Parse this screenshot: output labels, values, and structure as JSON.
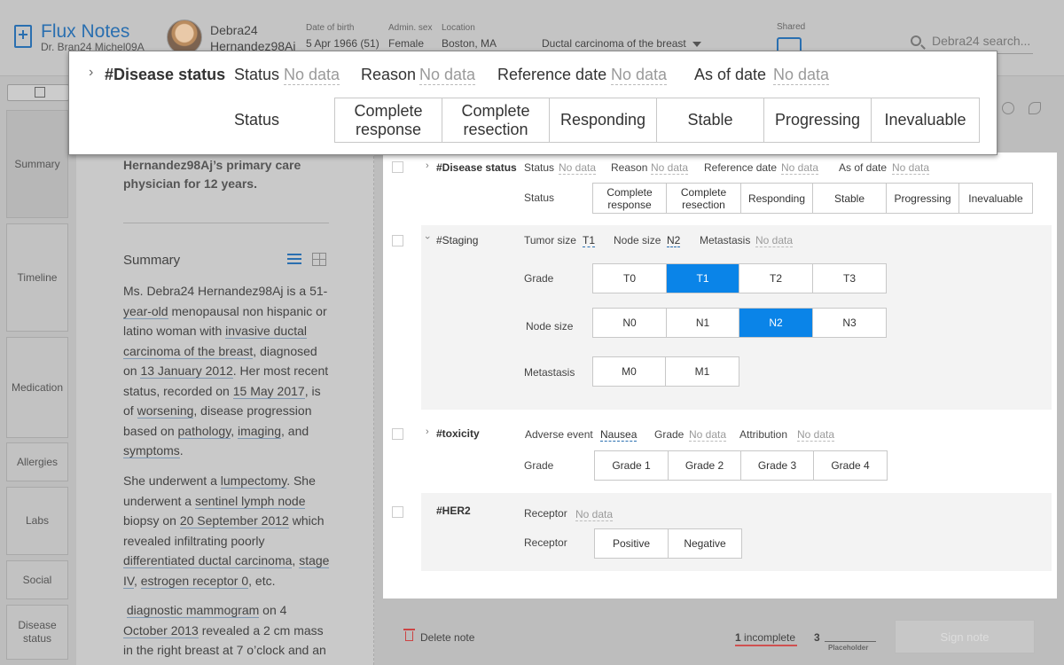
{
  "app": {
    "title": "Flux Notes",
    "user": "Dr. Bran24 Michel09A"
  },
  "patient": {
    "name_first": "Debra24",
    "name_last": "Hernandez98Aj",
    "dob_label": "Date of birth",
    "dob": "5 Apr 1966 (51)",
    "sex_label": "Admin. sex",
    "sex": "Female",
    "location_label": "Location",
    "location": "Boston, MA",
    "condition": "Ductal carcinoma of the breast"
  },
  "shared_label": "Shared",
  "search_placeholder": "Debra24 search...",
  "nav": [
    "Summary",
    "Timeline",
    "Medication",
    "Allergies",
    "Labs",
    "Social",
    "Disease status"
  ],
  "summary": {
    "intro": "Hernandez98Aj’s primary care physician for 12 years.",
    "heading": "Summary"
  },
  "popup": {
    "tag": "#Disease status",
    "status_label": "Status",
    "reason_label": "Reason",
    "ref_date_label": "Reference date",
    "as_of_label": "As of date",
    "no_data": "No data",
    "options_label": "Status",
    "options": [
      "Complete response",
      "Complete resection",
      "Responding",
      "Stable",
      "Progressing",
      "Inevaluable"
    ]
  },
  "panel": {
    "no_data": "No data",
    "disease": {
      "tag": "#Disease status",
      "status_label": "Status",
      "reason_label": "Reason",
      "ref_date_label": "Reference date",
      "as_of_label": "As of date",
      "options_label": "Status",
      "options": [
        "Complete response",
        "Complete resection",
        "Responding",
        "Stable",
        "Progressing",
        "Inevaluable"
      ]
    },
    "staging": {
      "tag": "#Staging",
      "tumor_label": "Tumor size",
      "tumor_val": "T1",
      "node_label": "Node size",
      "node_val": "N2",
      "metastasis_label": "Metastasis",
      "grade_label": "Grade",
      "grade_options": [
        "T0",
        "T1",
        "T2",
        "T3"
      ],
      "grade_selected": "T1",
      "node_row_label": "Node size",
      "node_options": [
        "N0",
        "N1",
        "N2",
        "N3"
      ],
      "node_selected": "N2",
      "meta_row_label": "Metastasis",
      "meta_options": [
        "M0",
        "M1"
      ]
    },
    "toxicity": {
      "tag": "#toxicity",
      "adverse_label": "Adverse event",
      "adverse_val": "Nausea",
      "grade_label": "Grade",
      "attribution_label": "Attribution",
      "options_label": "Grade",
      "options": [
        "Grade 1",
        "Grade 2",
        "Grade 3",
        "Grade 4"
      ]
    },
    "her2": {
      "tag": "#HER2",
      "receptor_label": "Receptor",
      "options_label": "Receptor",
      "options": [
        "Positive",
        "Negative"
      ]
    }
  },
  "footer": {
    "delete": "Delete note",
    "incomplete_count": "1",
    "incomplete_label": "incomplete",
    "placeholder_count": "3",
    "placeholder_label": "Placeholder",
    "sign": "Sign note"
  }
}
